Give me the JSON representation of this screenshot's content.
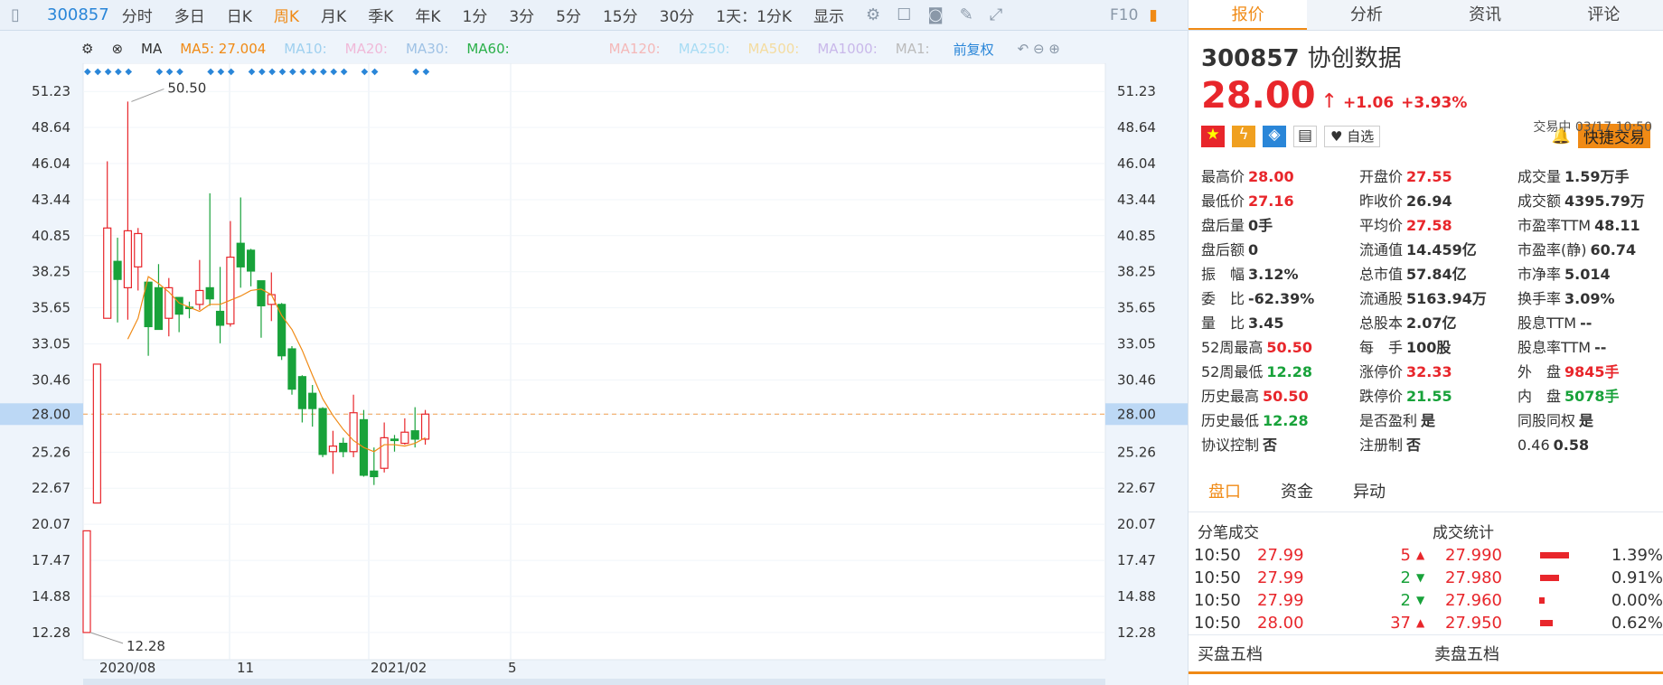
{
  "toolbar": {
    "code": "300857",
    "periods": [
      "分时",
      "多日",
      "日K",
      "周K",
      "月K",
      "季K",
      "年K",
      "1分",
      "3分",
      "5分",
      "15分",
      "30分"
    ],
    "active_period": "周K",
    "range": "1天：1分K",
    "display": "显示"
  },
  "ma": {
    "label": "MA",
    "ma5": "MA5: 27.004",
    "ma10": "MA10:",
    "ma20": "MA20:",
    "ma30": "MA30:",
    "ma60": "MA60:",
    "ma120": "MA120:",
    "ma250": "MA250:",
    "ma500": "MA500:",
    "ma1000": "MA1000:",
    "ma1": "MA1:",
    "adjust": "前复权"
  },
  "y_labels": [
    "51.23",
    "48.64",
    "46.04",
    "43.44",
    "40.85",
    "38.25",
    "35.65",
    "33.05",
    "30.46",
    "28.00",
    "25.26",
    "22.67",
    "20.07",
    "17.47",
    "14.88",
    "12.28"
  ],
  "x_labels": [
    "2020/08",
    "11",
    "2021/02",
    "5"
  ],
  "annot": {
    "high": "50.50",
    "low": "12.28"
  },
  "chart_data": {
    "type": "candlestick",
    "x_labels": [
      "2020/08",
      "11",
      "2021/02",
      "5"
    ],
    "y_ticks": [
      51.23,
      48.64,
      46.04,
      43.44,
      40.85,
      38.25,
      35.65,
      33.05,
      30.46,
      28.0,
      25.26,
      22.67,
      20.07,
      17.47,
      14.88,
      12.28
    ],
    "current_price": 28.0,
    "max": 50.5,
    "min": 12.28,
    "candles": [
      [
        12.28,
        19.6,
        12.28,
        19.6
      ],
      [
        21.6,
        31.6,
        21.6,
        31.6
      ],
      [
        34.9,
        41.4,
        34.9,
        46.2
      ],
      [
        39.0,
        37.7,
        34.6,
        40.7
      ],
      [
        37.1,
        41.2,
        34.8,
        50.5
      ],
      [
        38.6,
        41.0,
        36.9,
        41.4
      ],
      [
        37.5,
        34.3,
        32.2,
        37.5
      ],
      [
        37.1,
        34.1,
        34.1,
        38.8
      ],
      [
        34.9,
        37.1,
        33.6,
        37.8
      ],
      [
        36.4,
        35.2,
        33.9,
        36.3
      ],
      [
        35.7,
        35.6,
        34.9,
        36.1
      ],
      [
        35.9,
        36.9,
        35.5,
        39.1
      ],
      [
        37.1,
        36.3,
        35.8,
        43.9
      ],
      [
        35.4,
        34.4,
        33.1,
        38.6
      ],
      [
        34.5,
        39.3,
        34.3,
        41.9
      ],
      [
        40.3,
        38.6,
        37.1,
        43.6
      ],
      [
        39.8,
        38.3,
        37.2,
        39.9
      ],
      [
        37.6,
        35.8,
        33.5,
        37.6
      ],
      [
        35.9,
        36.6,
        34.7,
        38.2
      ],
      [
        35.9,
        32.2,
        31.9,
        36.0
      ],
      [
        32.7,
        29.8,
        29.4,
        32.9
      ],
      [
        30.7,
        28.4,
        27.4,
        30.8
      ],
      [
        29.5,
        28.4,
        27.1,
        30.1
      ],
      [
        28.4,
        25.1,
        24.9,
        28.5
      ],
      [
        25.3,
        25.7,
        23.7,
        26.8
      ],
      [
        25.9,
        25.3,
        24.9,
        26.3
      ],
      [
        25.3,
        28.1,
        24.9,
        29.4
      ],
      [
        27.6,
        23.6,
        23.5,
        28.3
      ],
      [
        23.9,
        23.5,
        22.9,
        25.6
      ],
      [
        24.1,
        26.3,
        23.8,
        27.4
      ],
      [
        26.2,
        26.1,
        25.3,
        26.5
      ],
      [
        25.9,
        26.7,
        25.8,
        27.7
      ],
      [
        26.8,
        26.2,
        25.6,
        28.5
      ],
      [
        26.2,
        28.0,
        25.8,
        28.3
      ]
    ],
    "ma5": [
      null,
      null,
      null,
      null,
      33.4,
      34.9,
      37.9,
      37.4,
      36.8,
      36.0,
      35.7,
      35.4,
      35.9,
      35.9,
      36.2,
      36.5,
      36.9,
      37.0,
      36.6,
      35.1,
      34.1,
      32.6,
      30.8,
      29.1,
      27.9,
      26.9,
      26.1,
      25.6,
      25.3,
      25.8,
      25.8,
      25.7,
      25.9,
      26.3
    ]
  },
  "right": {
    "tabs": [
      "报价",
      "分析",
      "资讯",
      "评论"
    ],
    "code": "300857",
    "name": "协创数据",
    "price": "28.00",
    "change": "+1.06",
    "pct": "+3.93%",
    "status": "交易中 03/17 10:50",
    "watch": "自选",
    "trade": "快捷交易",
    "rows": [
      [
        "最高价",
        "28.00",
        "red",
        "开盘价",
        "27.55",
        "red",
        "成交量",
        "1.59万手",
        ""
      ],
      [
        "最低价",
        "27.16",
        "red",
        "昨收价",
        "26.94",
        "",
        "成交额",
        "4395.79万",
        ""
      ],
      [
        "盘后量",
        "0手",
        "",
        "平均价",
        "27.58",
        "red",
        "市盈率TTM",
        "48.11",
        ""
      ],
      [
        "盘后额",
        "0",
        "",
        "流通值",
        "14.459亿",
        "",
        "市盈率(静)",
        "60.74",
        ""
      ],
      [
        "振　幅",
        "3.12%",
        "",
        "总市值",
        "57.84亿",
        "",
        "市净率",
        "5.014",
        ""
      ],
      [
        "委　比",
        "-62.39%",
        "",
        "流通股",
        "5163.94万",
        "",
        "换手率",
        "3.09%",
        ""
      ],
      [
        "量　比",
        "3.45",
        "",
        "总股本",
        "2.07亿",
        "",
        "股息TTM",
        "--",
        ""
      ],
      [
        "52周最高",
        "50.50",
        "red",
        "每　手",
        "100股",
        "",
        "股息率TTM",
        "--",
        ""
      ],
      [
        "52周最低",
        "12.28",
        "green",
        "涨停价",
        "32.33",
        "red",
        "外　盘",
        "9845手",
        "red"
      ],
      [
        "历史最高",
        "50.50",
        "red",
        "跌停价",
        "21.55",
        "green",
        "内　盘",
        "5078手",
        "green"
      ],
      [
        "历史最低",
        "12.28",
        "green",
        "是否盈利",
        "是",
        "",
        "同股同权",
        "是",
        ""
      ],
      [
        "协议控制",
        "否",
        "",
        "注册制",
        "否",
        "",
        "0.46",
        "0.58",
        ""
      ]
    ],
    "btabs": [
      "盘口",
      "资金",
      "异动"
    ],
    "ticks_title": "分笔成交",
    "stats_title": "成交统计",
    "ticks": [
      [
        "10:50",
        "27.99",
        "5",
        "up"
      ],
      [
        "10:50",
        "27.99",
        "2",
        "down"
      ],
      [
        "10:50",
        "27.99",
        "2",
        "down"
      ],
      [
        "10:50",
        "28.00",
        "37",
        "up"
      ]
    ],
    "stats": [
      [
        "27.990",
        "1.39%"
      ],
      [
        "27.980",
        "0.91%"
      ],
      [
        "27.960",
        "0.00%"
      ],
      [
        "27.950",
        "0.62%"
      ]
    ],
    "bottom": [
      "买盘五档",
      "卖盘五档"
    ]
  }
}
